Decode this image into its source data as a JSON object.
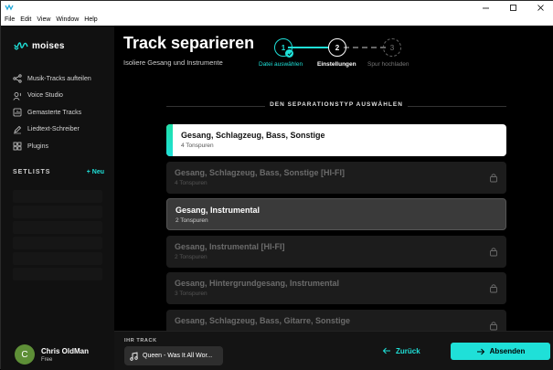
{
  "menubar": [
    "File",
    "Edit",
    "View",
    "Window",
    "Help"
  ],
  "brand": {
    "name": "moises",
    "accent": "#1fe0d8"
  },
  "sidebar": {
    "items": [
      {
        "label": "Musik-Tracks aufteilen",
        "icon": "split-icon"
      },
      {
        "label": "Voice Studio",
        "icon": "voice-icon"
      },
      {
        "label": "Gemasterte Tracks",
        "icon": "master-icon"
      },
      {
        "label": "Liedtext-Schreiber",
        "icon": "pen-icon"
      },
      {
        "label": "Plugins",
        "icon": "plugins-icon"
      }
    ],
    "setlists_title": "SETLISTS",
    "setlists_new": "+ Neu"
  },
  "user": {
    "initial": "C",
    "name": "Chris OldMan",
    "plan": "Free",
    "avatar_color": "#5e8f37"
  },
  "page": {
    "title": "Track separieren",
    "subtitle": "Isoliere Gesang und Instrumente"
  },
  "steps": [
    {
      "number": "1",
      "label": "Datei auswählen",
      "state": "done"
    },
    {
      "number": "2",
      "label": "Einstellungen",
      "state": "active"
    },
    {
      "number": "3",
      "label": "Spur hochladen",
      "state": "pending"
    }
  ],
  "section_title": "DEN SEPARATIONSTYP AUSWÄHLEN",
  "options": [
    {
      "title": "Gesang, Schlagzeug, Bass, Sonstige",
      "sub": "4 Tonspuren",
      "state": "selected"
    },
    {
      "title": "Gesang, Schlagzeug, Bass, Sonstige [HI-FI]",
      "sub": "4 Tonspuren",
      "state": "locked"
    },
    {
      "title": "Gesang, Instrumental",
      "sub": "2 Tonspuren",
      "state": "normal"
    },
    {
      "title": "Gesang, Instrumental [HI-FI]",
      "sub": "2 Tonspuren",
      "state": "locked"
    },
    {
      "title": "Gesang, Hintergrundgesang, Instrumental",
      "sub": "3 Tonspuren",
      "state": "locked"
    },
    {
      "title": "Gesang, Schlagzeug, Bass, Gitarre, Sonstige",
      "sub": "",
      "state": "locked"
    }
  ],
  "footer": {
    "track_label": "IHR TRACK",
    "track_name": "Queen - Was It All Wor...",
    "back_label": "Zurück",
    "submit_label": "Absenden"
  }
}
